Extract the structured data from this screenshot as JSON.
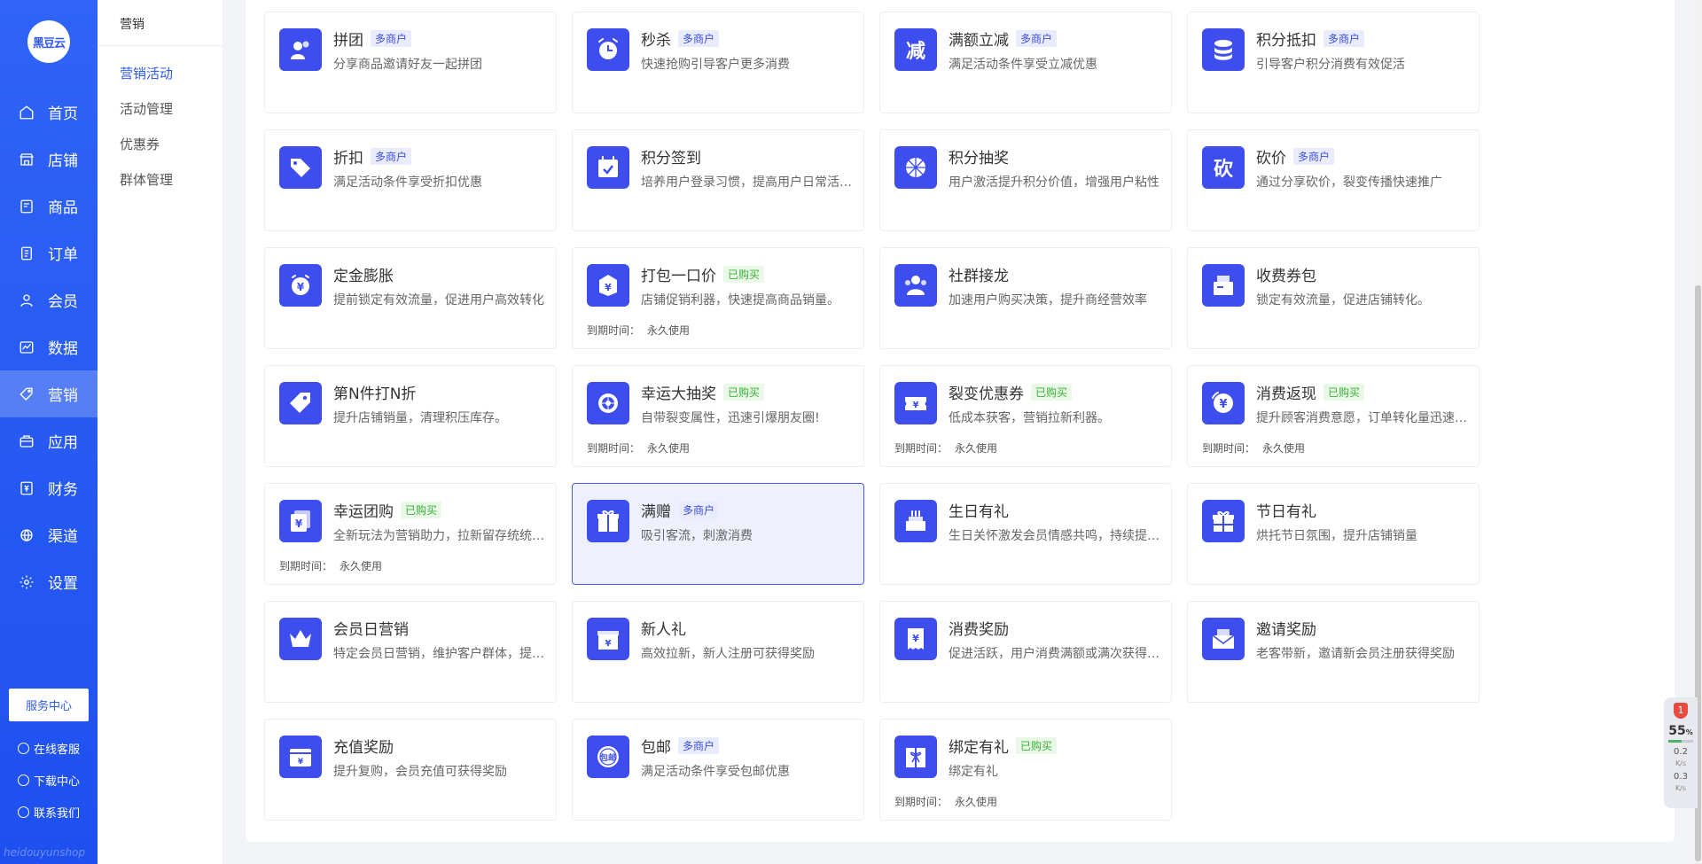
{
  "brand": {
    "logo_text": "黑豆云",
    "watermark": "heidouyunshop"
  },
  "nav": {
    "items": [
      {
        "label": "首页",
        "icon": "home-icon"
      },
      {
        "label": "店铺",
        "icon": "store-icon"
      },
      {
        "label": "商品",
        "icon": "goods-icon"
      },
      {
        "label": "订单",
        "icon": "order-icon"
      },
      {
        "label": "会员",
        "icon": "member-icon"
      },
      {
        "label": "数据",
        "icon": "chart-icon"
      },
      {
        "label": "营销",
        "icon": "tag-icon",
        "active": true
      },
      {
        "label": "应用",
        "icon": "app-icon"
      },
      {
        "label": "财务",
        "icon": "finance-icon"
      },
      {
        "label": "渠道",
        "icon": "channel-icon"
      },
      {
        "label": "设置",
        "icon": "gear-icon"
      }
    ],
    "service_center": "服务中心",
    "links": [
      "在线客服",
      "下载中心",
      "联系我们"
    ]
  },
  "subnav": {
    "title": "营销",
    "items": [
      "营销活动",
      "活动管理",
      "优惠券",
      "群体管理"
    ],
    "active_index": 0
  },
  "cards": [
    {
      "title": "拼团",
      "tag": "多商户",
      "tag_type": "multi",
      "desc": "分享商品邀请好友一起拼团",
      "icon": "group-icon"
    },
    {
      "title": "秒杀",
      "tag": "多商户",
      "tag_type": "multi",
      "desc": "快速抢购引导客户更多消费",
      "icon": "alarm-clock-icon"
    },
    {
      "title": "满额立减",
      "tag": "多商户",
      "tag_type": "multi",
      "desc": "满足活动条件享受立减优惠",
      "icon": "discount-char-icon"
    },
    {
      "title": "积分抵扣",
      "tag": "多商户",
      "tag_type": "multi",
      "desc": "引导客户积分消费有效促活",
      "icon": "coins-icon"
    },
    {
      "title": "折扣",
      "tag": "多商户",
      "tag_type": "multi",
      "desc": "满足活动条件享受折扣优惠",
      "icon": "price-tag-icon"
    },
    {
      "title": "积分签到",
      "tag": "",
      "tag_type": "",
      "desc": "培养用户登录习惯，提高用户日常活跃度",
      "icon": "calendar-check-icon"
    },
    {
      "title": "积分抽奖",
      "tag": "",
      "tag_type": "",
      "desc": "用户激活提升积分价值，增强用户粘性",
      "icon": "wheel-icon"
    },
    {
      "title": "砍价",
      "tag": "多商户",
      "tag_type": "multi",
      "desc": "通过分享砍价，裂变传播快速推广",
      "icon": "bargain-char-icon"
    },
    {
      "title": "定金膨胀",
      "tag": "",
      "tag_type": "",
      "desc": "提前锁定有效流量，促进用户高效转化",
      "icon": "yen-clock-icon"
    },
    {
      "title": "打包一口价",
      "tag": "已购买",
      "tag_type": "bought",
      "desc": "店铺促销利器，快速提高商品销量。",
      "icon": "package-yen-icon",
      "expire_label": "到期时间：",
      "expire_value": "永久使用"
    },
    {
      "title": "社群接龙",
      "tag": "",
      "tag_type": "",
      "desc": "加速用户购买决策，提升商经营效率",
      "icon": "community-icon"
    },
    {
      "title": "收费券包",
      "tag": "",
      "tag_type": "",
      "desc": "锁定有效流量，促进店铺转化。",
      "icon": "coupon-box-icon"
    },
    {
      "title": "第N件打N折",
      "tag": "",
      "tag_type": "",
      "desc": "提升店铺销量，清理积压库存。",
      "icon": "label-icon"
    },
    {
      "title": "幸运大抽奖",
      "tag": "已购买",
      "tag_type": "bought",
      "desc": "自带裂变属性，迅速引爆朋友圈!",
      "icon": "lucky-wheel-icon",
      "expire_label": "到期时间：",
      "expire_value": "永久使用"
    },
    {
      "title": "裂变优惠券",
      "tag": "已购买",
      "tag_type": "bought",
      "desc": "低成本获客，营销拉新利器。",
      "icon": "ticket-yen-icon",
      "expire_label": "到期时间：",
      "expire_value": "永久使用"
    },
    {
      "title": "消费返现",
      "tag": "已购买",
      "tag_type": "bought",
      "desc": "提升顾客消费意愿，订单转化量迅速提升",
      "icon": "cashback-icon",
      "expire_label": "到期时间：",
      "expire_value": "永久使用"
    },
    {
      "title": "幸运团购",
      "tag": "已购买",
      "tag_type": "bought",
      "desc": "全新玩法为营销助力，拉新留存统统搞定",
      "icon": "yen-card-icon",
      "expire_label": "到期时间：",
      "expire_value": "永久使用"
    },
    {
      "title": "满赠",
      "tag": "多商户",
      "tag_type": "multi",
      "desc": "吸引客流，刺激消费",
      "icon": "gift-box-icon",
      "selected": true
    },
    {
      "title": "生日有礼",
      "tag": "",
      "tag_type": "",
      "desc": "生日关怀激发会员情感共鸣，持续提升复购",
      "icon": "cake-icon"
    },
    {
      "title": "节日有礼",
      "tag": "",
      "tag_type": "",
      "desc": "烘托节日氛围，提升店铺销量",
      "icon": "festival-gift-icon"
    },
    {
      "title": "会员日营销",
      "tag": "",
      "tag_type": "",
      "desc": "特定会员日营销，维护客户群体，提升复购",
      "icon": "crown-icon"
    },
    {
      "title": "新人礼",
      "tag": "",
      "tag_type": "",
      "desc": "高效拉新，新人注册可获得奖励",
      "icon": "new-gift-icon"
    },
    {
      "title": "消费奖励",
      "tag": "",
      "tag_type": "",
      "desc": "促进活跃，用户消费满额或满次获得奖励",
      "icon": "receipt-yen-icon"
    },
    {
      "title": "邀请奖励",
      "tag": "",
      "tag_type": "",
      "desc": "老客带新，邀请新会员注册获得奖励",
      "icon": "envelope-yen-icon"
    },
    {
      "title": "充值奖励",
      "tag": "",
      "tag_type": "",
      "desc": "提升复购，会员充值可获得奖励",
      "icon": "wallet-yen-icon"
    },
    {
      "title": "包邮",
      "tag": "多商户",
      "tag_type": "multi",
      "desc": "满足活动条件享受包邮优惠",
      "icon": "free-shipping-icon"
    },
    {
      "title": "绑定有礼",
      "tag": "已购买",
      "tag_type": "bought",
      "desc": "绑定有礼",
      "icon": "bind-gift-icon",
      "expire_label": "到期时间：",
      "expire_value": "永久使用"
    }
  ],
  "widget": {
    "badge": "1",
    "percent": "55",
    "percent_unit": "%",
    "cpu_fraction": 0.55,
    "up": "0.2",
    "down": "0.3",
    "unit": "K/s"
  },
  "colors": {
    "sidebar": "#2f64f6",
    "accent": "#3e4dee",
    "multi_tag": "#3b4de6",
    "bought_tag": "#38b03a"
  }
}
